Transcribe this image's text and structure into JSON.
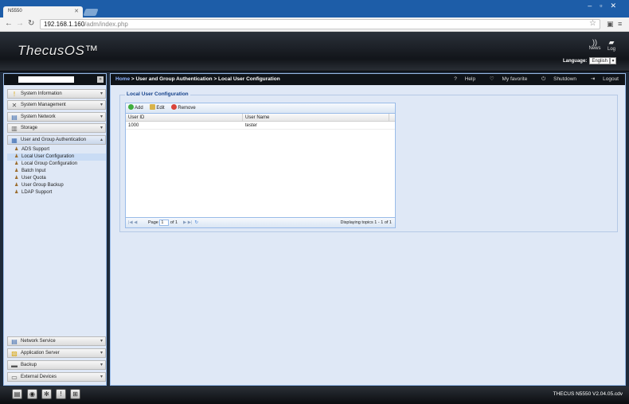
{
  "browser": {
    "tab_title": "N5550",
    "url_host": "192.168.1.160",
    "url_path": "/adm/index.php"
  },
  "header": {
    "logo": "ThecusOS™",
    "news_label": "News",
    "log_label": "Log",
    "language_label": "Language:",
    "language_value": "English"
  },
  "sidebar": {
    "groups_top": [
      {
        "label": "System Information"
      },
      {
        "label": "System Management"
      },
      {
        "label": "System Network"
      },
      {
        "label": "Storage"
      },
      {
        "label": "User and Group Authentication"
      }
    ],
    "subitems": [
      {
        "label": "ADS Support"
      },
      {
        "label": "Local User Configuration"
      },
      {
        "label": "Local Group Configuration"
      },
      {
        "label": "Batch Input"
      },
      {
        "label": "User Quota"
      },
      {
        "label": "User Group Backup"
      },
      {
        "label": "LDAP Support"
      }
    ],
    "groups_bottom": [
      {
        "label": "Network Service"
      },
      {
        "label": "Application Server"
      },
      {
        "label": "Backup"
      },
      {
        "label": "External Devices"
      }
    ]
  },
  "breadcrumb": {
    "home": "Home",
    "rest": " > User and Group Authentication > Local User Configuration"
  },
  "actions": {
    "help": "Help",
    "favorite": "My favorite",
    "shutdown": "Shutdown",
    "logout": "Logout"
  },
  "panel": {
    "title": "Local User Configuration",
    "toolbar": {
      "add": "Add",
      "edit": "Edit",
      "remove": "Remove"
    },
    "columns": [
      "User ID",
      "User Name"
    ],
    "rows": [
      [
        "1000",
        "tester"
      ]
    ],
    "paging": {
      "page_label": "Page",
      "page_value": "1",
      "of_label": "of 1",
      "display": "Displaying topics 1 - 1 of 1"
    }
  },
  "footer": {
    "version": "THECUS N5550 V2.04.05.cdv"
  }
}
